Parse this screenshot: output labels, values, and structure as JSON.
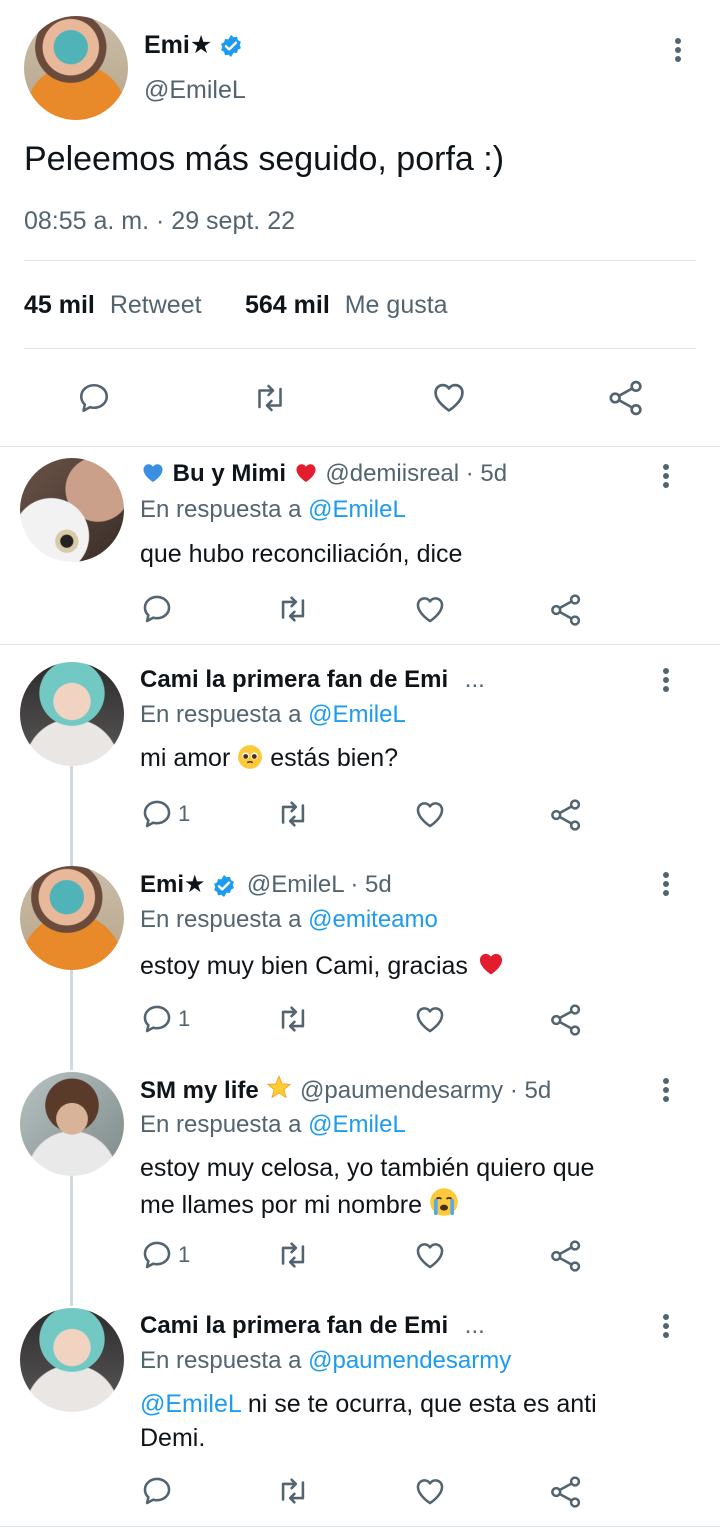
{
  "main_tweet": {
    "display_name": "Emi★",
    "handle": "@EmileL",
    "text": "Peleemos más seguido, porfa  :)",
    "timestamp": "08:55 a. m. · 29 sept. 22",
    "retweets_count": "45 mil",
    "retweets_label": "Retweet",
    "likes_count": "564 mil",
    "likes_label": "Me gusta"
  },
  "replies": [
    {
      "display_name": "Bu y Mimi",
      "handle": "@demiisreal",
      "time": "· 5d",
      "reply_prefix": "En respuesta a",
      "reply_to": "@EmileL",
      "text": "que hubo reconciliación, dice",
      "reply_count": ""
    },
    {
      "display_name": "Cami la primera fan de Emi",
      "ellipsis": "...",
      "reply_prefix": "En respuesta a",
      "reply_to": "@EmileL",
      "text_before": "mi amor",
      "text_after": "estás bien?",
      "reply_count": "1"
    },
    {
      "display_name": "Emi★",
      "handle": "@EmileL",
      "time": "· 5d",
      "reply_prefix": "En respuesta a",
      "reply_to": "@emiteamo",
      "text": "estoy muy bien Cami, gracias",
      "reply_count": "1"
    },
    {
      "display_name": "SM my life",
      "handle": "@paumendesarmy",
      "time": "· 5d",
      "reply_prefix": "En respuesta a",
      "reply_to": "@EmileL",
      "text_line1": "estoy muy celosa, yo también quiero que",
      "text_line2": "me llames por mi nombre",
      "reply_count": "1"
    },
    {
      "display_name": "Cami la primera fan de Emi",
      "ellipsis": "...",
      "reply_prefix": "En respuesta a",
      "reply_to": "@paumendesarmy",
      "mention": "@EmileL",
      "text_line1": "ni se te ocurra, que esta es anti",
      "text_line2": "Demi.",
      "reply_count": ""
    }
  ],
  "colors": {
    "accent": "#1d9bf0",
    "secondary_text": "#536471",
    "heart": "#e0245e"
  }
}
